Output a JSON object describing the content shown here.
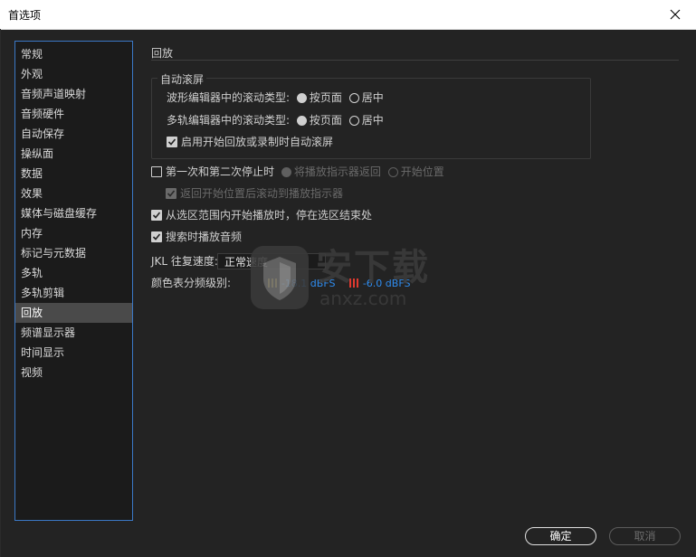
{
  "window": {
    "title": "首选项"
  },
  "sidebar": {
    "items": [
      {
        "label": "常规"
      },
      {
        "label": "外观"
      },
      {
        "label": "音频声道映射"
      },
      {
        "label": "音频硬件"
      },
      {
        "label": "自动保存"
      },
      {
        "label": "操纵面"
      },
      {
        "label": "数据"
      },
      {
        "label": "效果"
      },
      {
        "label": "媒体与磁盘缓存"
      },
      {
        "label": "内存"
      },
      {
        "label": "标记与元数据"
      },
      {
        "label": "多轨"
      },
      {
        "label": "多轨剪辑"
      },
      {
        "label": "回放"
      },
      {
        "label": "频谱显示器"
      },
      {
        "label": "时间显示"
      },
      {
        "label": "视频"
      }
    ],
    "active": "回放"
  },
  "main": {
    "section_title": "回放",
    "auto_scroll": {
      "group_title": "自动滚屏",
      "waveform_label": "波形编辑器中的滚动类型:",
      "multitrack_label": "多轨编辑器中的滚动类型:",
      "option_page": "按页面",
      "option_center": "居中",
      "enable_label": "启用开始回放或录制时自动滚屏",
      "enable_checked": true
    },
    "stop_first_second": {
      "label": "第一次和第二次停止时",
      "checked": false,
      "option_return": "将播放指示器返回",
      "option_start": "开始位置",
      "sub_label": "返回开始位置后滚动到播放指示器",
      "sub_checked": true
    },
    "stop_at_selection": {
      "label": "从选区范围内开始播放时，停在选区结束处",
      "checked": true
    },
    "scrub_audio": {
      "label": "搜索时播放音频",
      "checked": true
    },
    "jkl": {
      "label": "JKL 往复速度:",
      "value": "正常速度"
    },
    "meter": {
      "label": "颜色表分频级别:",
      "value1": "-18.1 dBFS",
      "value2": "-6.0 dBFS"
    }
  },
  "buttons": {
    "ok": "确定",
    "cancel": "取消"
  },
  "watermark": {
    "text_main": "安下载",
    "text_sub": "anxz.com"
  },
  "colors": {
    "accent": "#3b78c5",
    "db_blue": "#2f8df0",
    "background": "#232323"
  }
}
